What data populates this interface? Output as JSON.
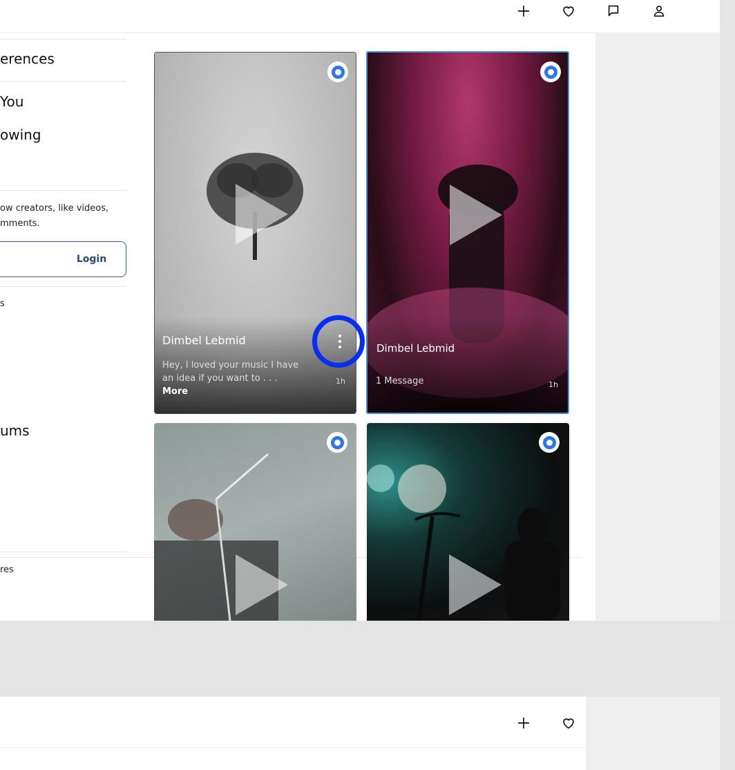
{
  "sidebar": {
    "preferences_label": "erences",
    "for_you_label": "You",
    "following_label": "owing",
    "login_prompt_line1": "ow creators, like videos,",
    "login_prompt_line2": "mments.",
    "login_button": "Login",
    "footer_fragment": "s",
    "albums_label": "ums",
    "bottom_fragment": "res"
  },
  "cards": [
    {
      "title": "Dimbel Lebmid",
      "message": "Hey, I loved your music I have an idea if you want to . . .",
      "more": "More",
      "time": "1h"
    },
    {
      "title": "Dimbel Lebmid",
      "message": "1 Message",
      "time": "1h"
    },
    {},
    {}
  ],
  "icons": {
    "add": "plus-icon",
    "like": "heart-icon",
    "messages": "message-icon",
    "profile": "user-icon"
  },
  "colors": {
    "accent_blue": "#2f74e8",
    "highlight_ring": "#0a2ef0",
    "login_border": "#3b5a8a"
  }
}
